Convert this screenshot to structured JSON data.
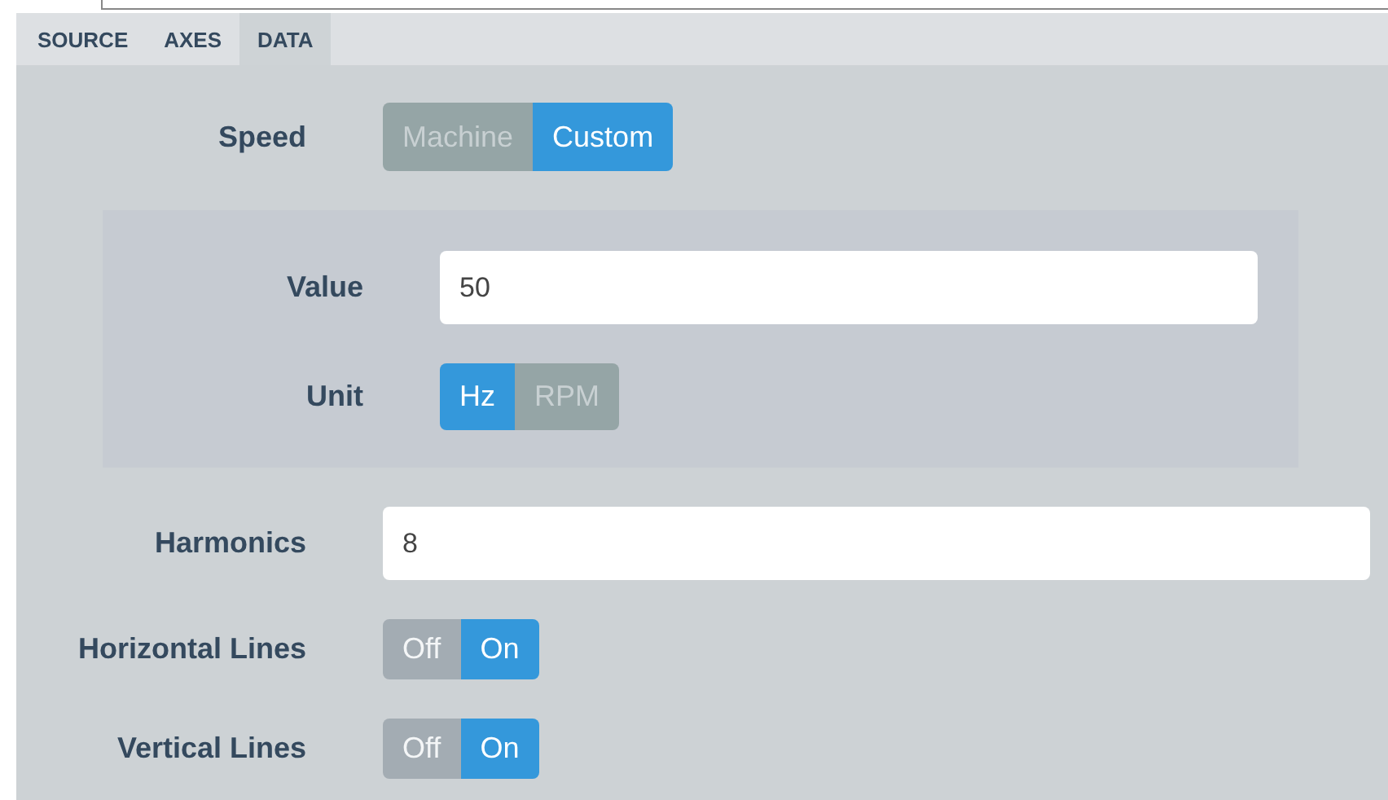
{
  "tabs": [
    {
      "label": "SOURCE",
      "selected": false
    },
    {
      "label": "AXES",
      "selected": false
    },
    {
      "label": "DATA",
      "selected": true
    }
  ],
  "rows": [
    {
      "kind": "segmented",
      "label": "Speed",
      "options": [
        {
          "label": "Machine",
          "selected": false
        },
        {
          "label": "Custom",
          "selected": true
        }
      ]
    },
    {
      "kind": "group",
      "rows": [
        {
          "kind": "field",
          "label": "Value",
          "value": "50"
        },
        {
          "kind": "segmented",
          "label": "Unit",
          "options": [
            {
              "label": "Hz",
              "selected": true
            },
            {
              "label": "RPM",
              "selected": false
            }
          ]
        }
      ]
    },
    {
      "kind": "field",
      "label": "Harmonics",
      "value": "8"
    },
    {
      "kind": "switch",
      "label": "Horizontal Lines",
      "options": [
        {
          "label": "Off",
          "selected": false
        },
        {
          "label": "On",
          "selected": true
        }
      ]
    },
    {
      "kind": "switch",
      "label": "Vertical Lines",
      "options": [
        {
          "label": "Off",
          "selected": false
        },
        {
          "label": "On",
          "selected": true
        }
      ]
    }
  ]
}
